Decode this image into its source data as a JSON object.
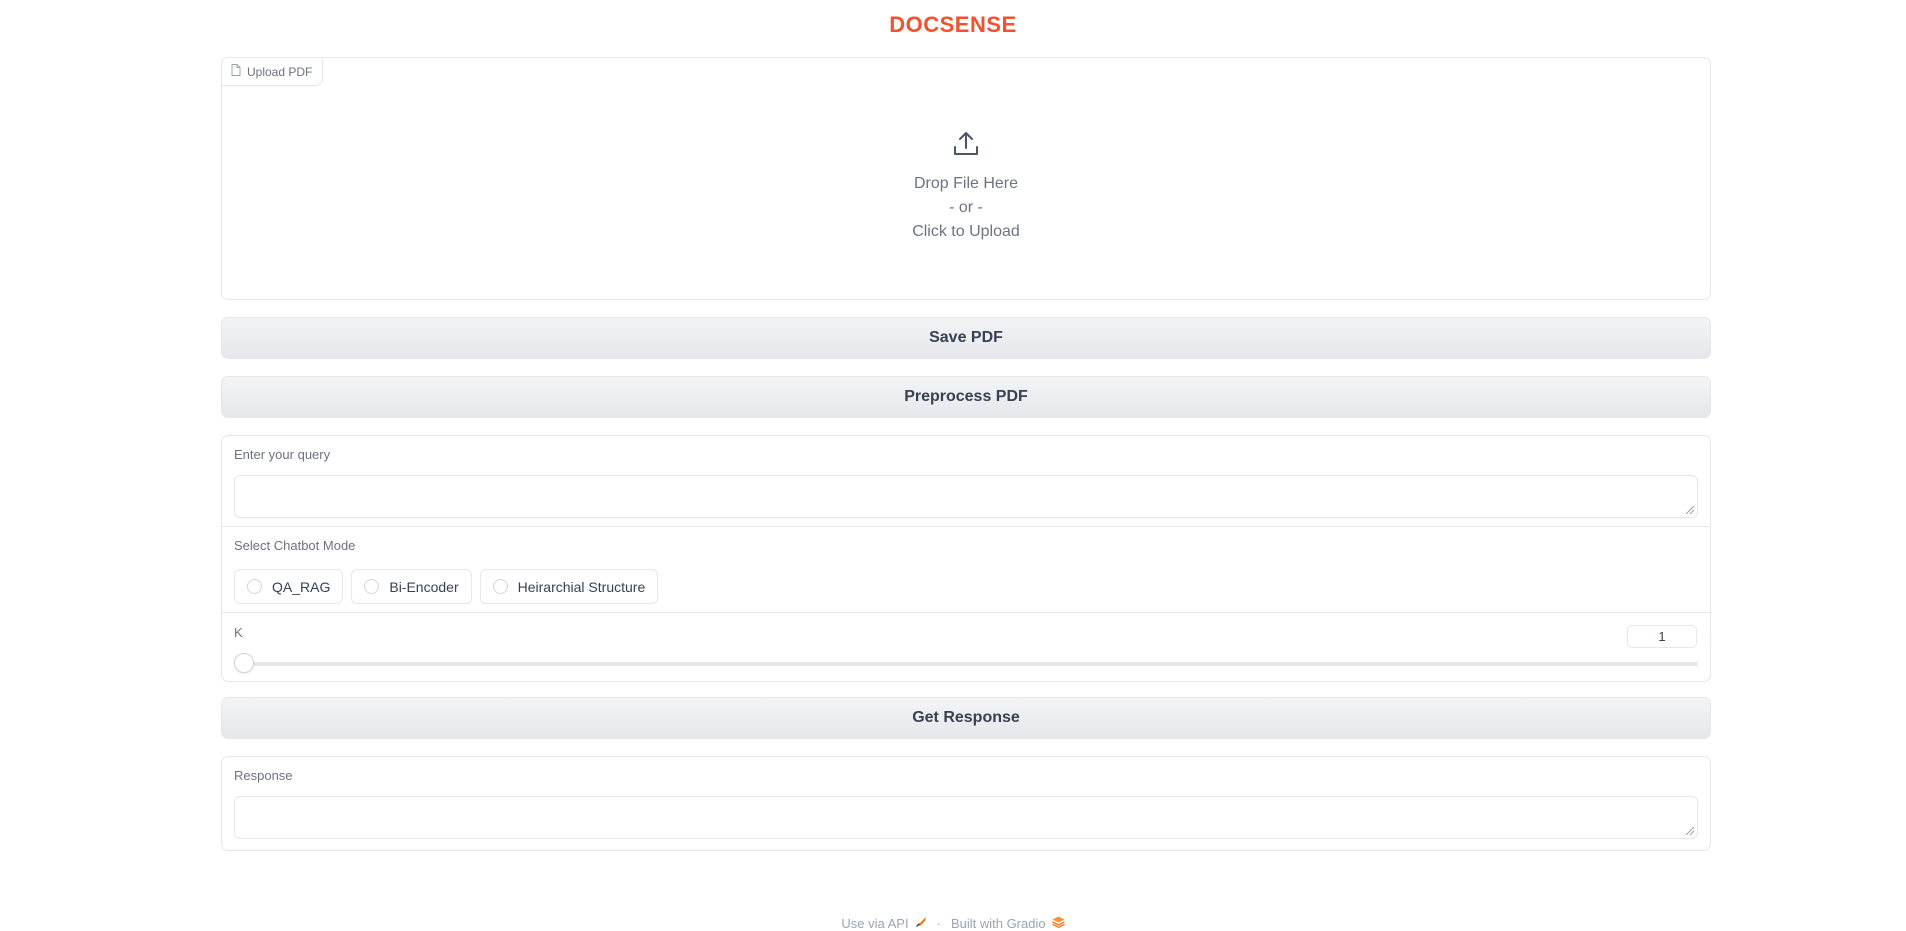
{
  "app": {
    "title": "DOCSENSE",
    "title_color": "#f4512c"
  },
  "upload": {
    "tab_label": "Upload PDF",
    "drop_text": "Drop File Here",
    "or_text": "- or -",
    "click_text": "Click to Upload"
  },
  "buttons": {
    "save_pdf": "Save PDF",
    "preprocess_pdf": "Preprocess PDF",
    "get_response": "Get Response"
  },
  "query": {
    "label": "Enter your query",
    "value": ""
  },
  "chatbot_mode": {
    "label": "Select Chatbot Mode",
    "options": [
      "QA_RAG",
      "Bi-Encoder",
      "Heirarchial Structure"
    ],
    "selected": null
  },
  "k_slider": {
    "label": "K",
    "value": "1",
    "level": 0.0
  },
  "response": {
    "label": "Response",
    "value": ""
  },
  "footer": {
    "api_text": "Use via API",
    "separator": "·",
    "built_text": "Built with Gradio"
  }
}
